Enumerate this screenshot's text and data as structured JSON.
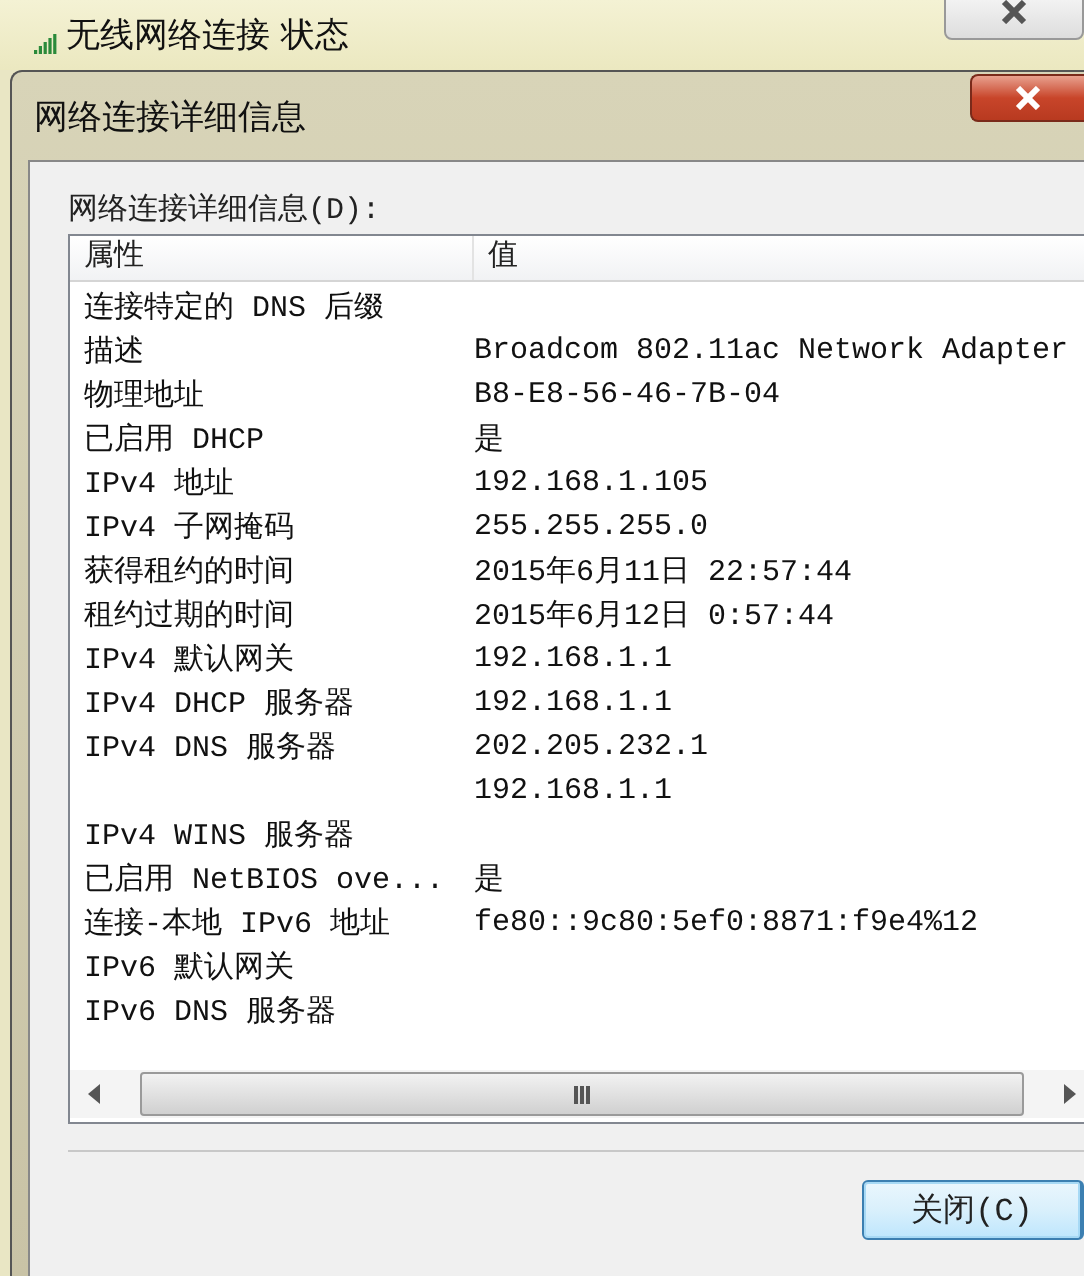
{
  "parent_window": {
    "title": "无线网络连接 状态"
  },
  "dialog": {
    "title": "网络连接详细信息",
    "list_label": "网络连接详细信息(D):"
  },
  "table": {
    "columns": [
      "属性",
      "值"
    ],
    "rows": [
      {
        "property": "连接特定的 DNS 后缀",
        "value": ""
      },
      {
        "property": "描述",
        "value": "Broadcom 802.11ac Network Adapter"
      },
      {
        "property": "物理地址",
        "value": "B8-E8-56-46-7B-04"
      },
      {
        "property": "已启用 DHCP",
        "value": "是"
      },
      {
        "property": "IPv4 地址",
        "value": "192.168.1.105"
      },
      {
        "property": "IPv4 子网掩码",
        "value": "255.255.255.0"
      },
      {
        "property": "获得租约的时间",
        "value": "2015年6月11日 22:57:44"
      },
      {
        "property": "租约过期的时间",
        "value": "2015年6月12日 0:57:44"
      },
      {
        "property": "IPv4 默认网关",
        "value": "192.168.1.1"
      },
      {
        "property": "IPv4 DHCP 服务器",
        "value": "192.168.1.1"
      },
      {
        "property": "IPv4 DNS 服务器",
        "value": "202.205.232.1"
      },
      {
        "property": "",
        "value": "192.168.1.1"
      },
      {
        "property": "IPv4 WINS 服务器",
        "value": ""
      },
      {
        "property": "已启用 NetBIOS ove...",
        "value": "是"
      },
      {
        "property": "连接-本地 IPv6 地址",
        "value": "fe80::9c80:5ef0:8871:f9e4%12"
      },
      {
        "property": "IPv6 默认网关",
        "value": ""
      },
      {
        "property": "IPv6 DNS 服务器",
        "value": ""
      }
    ]
  },
  "buttons": [
    "关闭(C)"
  ]
}
